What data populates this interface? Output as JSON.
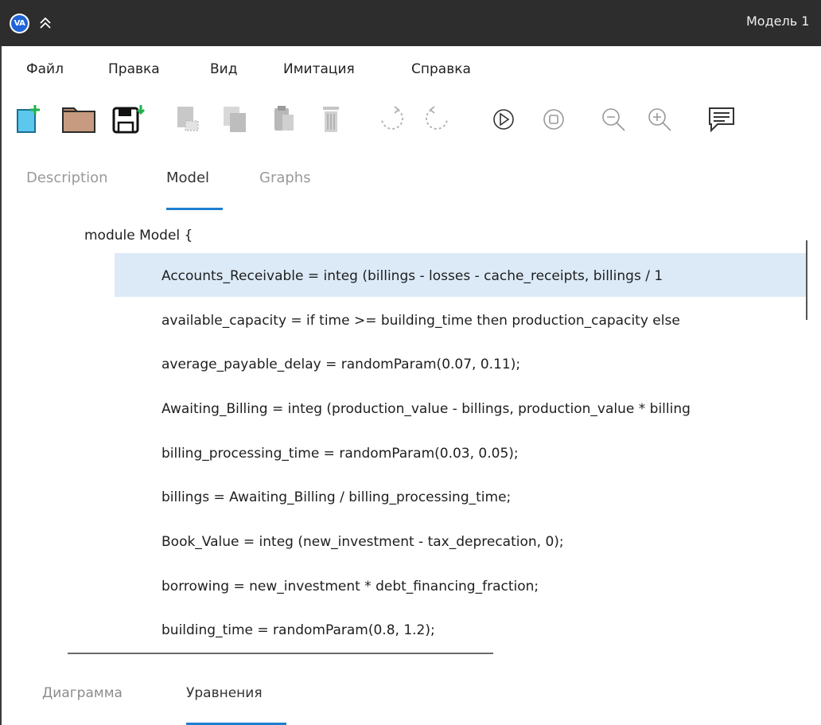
{
  "app": {
    "logo_text": "VA",
    "window_title": "Модель 1"
  },
  "menu": {
    "items": [
      "Файл",
      "Правка",
      "Вид",
      "Имитация",
      "Справка"
    ]
  },
  "toolbar": {
    "icons": [
      "new-file-icon",
      "open-folder-icon",
      "save-icon",
      "copy-icon",
      "duplicate-icon",
      "paste-icon",
      "delete-icon",
      "undo-icon",
      "redo-icon",
      "play-icon",
      "stop-icon",
      "zoom-out-icon",
      "zoom-in-icon",
      "comment-icon"
    ]
  },
  "tabs": {
    "items": [
      "Description",
      "Model",
      "Graphs"
    ],
    "active": "Model"
  },
  "code": {
    "header": "module Model {",
    "lines": [
      "Accounts_Receivable = integ (billings - losses - cache_receipts, billings / 1",
      "available_capacity = if time >= building_time then production_capacity else",
      "average_payable_delay = randomParam(0.07, 0.11);",
      "Awaiting_Billing = integ (production_value - billings, production_value * billing",
      "billing_processing_time = randomParam(0.03, 0.05);",
      "billings = Awaiting_Billing / billing_processing_time;",
      "Book_Value = integ (new_investment - tax_deprecation, 0);",
      "borrowing = new_investment * debt_financing_fraction;",
      "building_time = randomParam(0.8, 1.2);"
    ],
    "selected_line": 0
  },
  "bottom_tabs": {
    "items": [
      "Диаграмма",
      "Уравнения"
    ],
    "active": "Уравнения"
  },
  "colors": {
    "titlebar": "#2d2d2d",
    "accent": "#1d7fd1",
    "selection": "#dceaf8"
  }
}
